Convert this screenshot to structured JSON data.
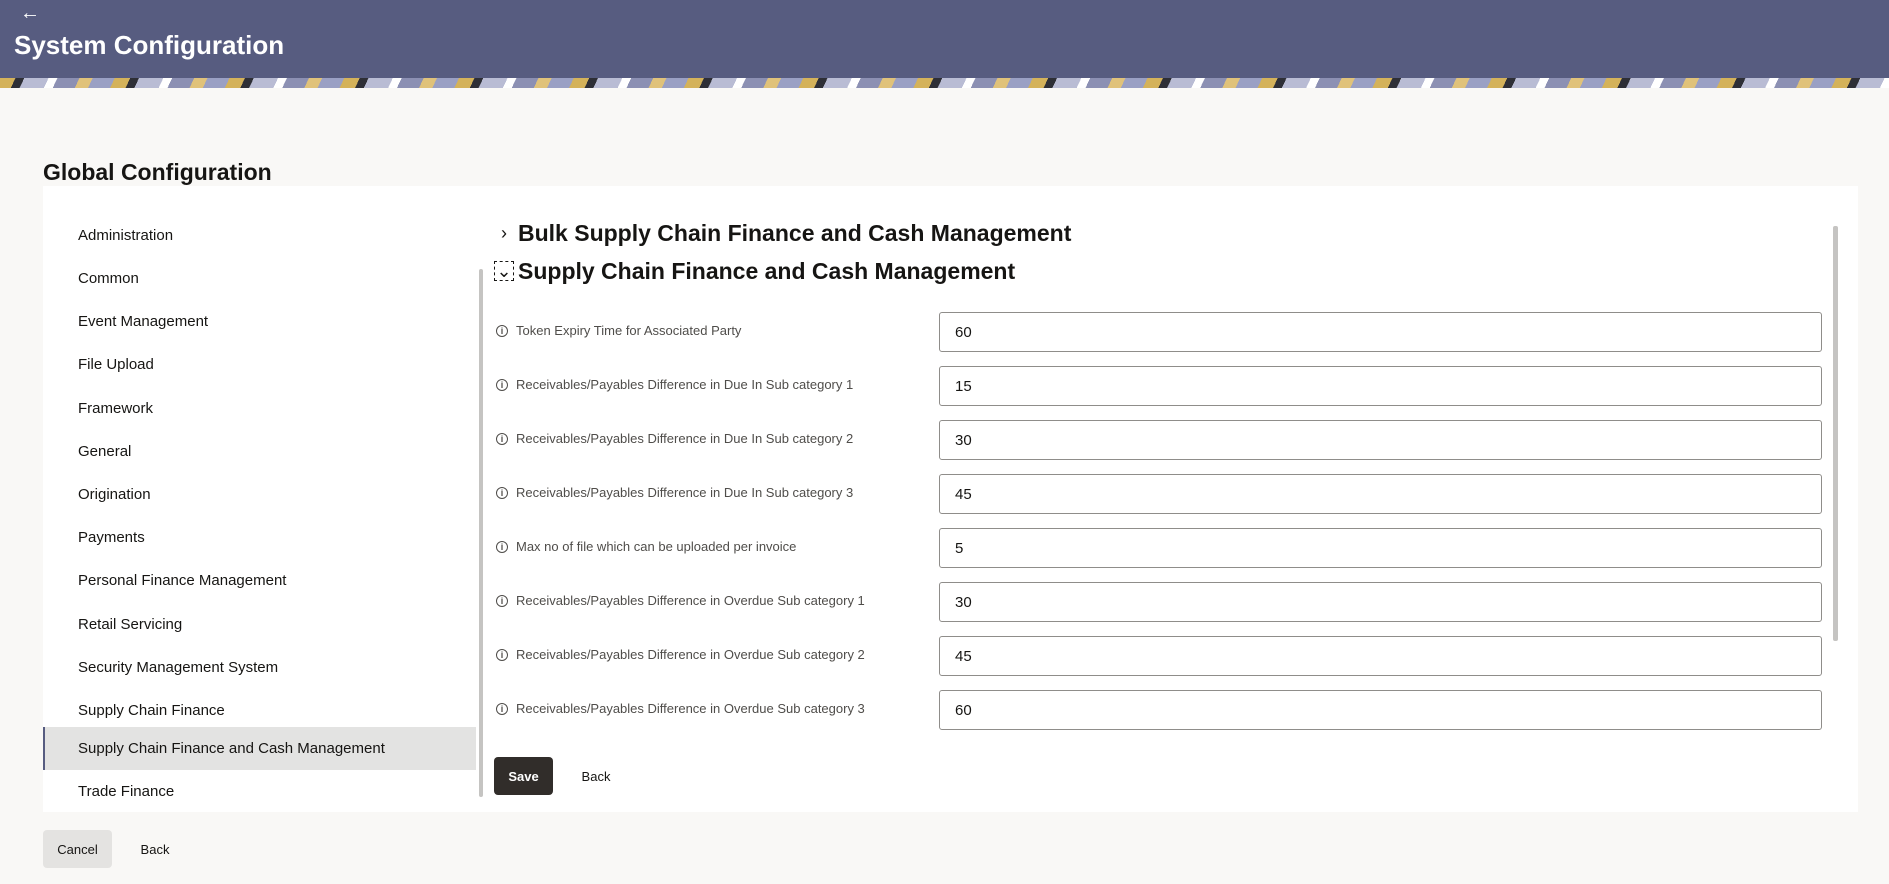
{
  "header": {
    "back_icon": "arrow-left-icon",
    "title": "System Configuration"
  },
  "section": {
    "title": "Global Configuration"
  },
  "nav": {
    "items": [
      {
        "label": "Administration"
      },
      {
        "label": "Common"
      },
      {
        "label": "Event Management"
      },
      {
        "label": "File Upload"
      },
      {
        "label": "Framework"
      },
      {
        "label": "General"
      },
      {
        "label": "Origination"
      },
      {
        "label": "Payments"
      },
      {
        "label": "Personal Finance Management"
      },
      {
        "label": "Retail Servicing"
      },
      {
        "label": "Security Management System"
      },
      {
        "label": "Supply Chain Finance"
      },
      {
        "label": "Supply Chain Finance and Cash Management"
      },
      {
        "label": "Trade Finance"
      }
    ],
    "active": "Supply Chain Finance and Cash Management"
  },
  "accordions": [
    {
      "label": "Bulk Supply Chain Finance and Cash Management",
      "expanded": false,
      "icon": "chevron-right-icon"
    },
    {
      "label": "Supply Chain Finance and Cash Management",
      "expanded": true,
      "icon": "chevron-down-icon"
    }
  ],
  "fields": [
    {
      "label": "Token Expiry Time for Associated Party",
      "value": "60"
    },
    {
      "label": "Receivables/Payables Difference in Due In Sub category 1",
      "value": "15"
    },
    {
      "label": "Receivables/Payables Difference in Due In Sub category 2",
      "value": "30"
    },
    {
      "label": "Receivables/Payables Difference in Due In Sub category 3",
      "value": "45"
    },
    {
      "label": "Max no of file which can be uploaded per invoice",
      "value": "5"
    },
    {
      "label": "Receivables/Payables Difference in Overdue Sub category 1",
      "value": "30"
    },
    {
      "label": "Receivables/Payables Difference in Overdue Sub category 2",
      "value": "45"
    },
    {
      "label": "Receivables/Payables Difference in Overdue Sub category 3",
      "value": "60"
    }
  ],
  "actions": {
    "save_label": "Save",
    "back_label": "Back",
    "cancel_label": "Cancel",
    "outer_back_label": "Back"
  },
  "colors": {
    "header_bg": "#575c80",
    "primary_button": "#312d2a",
    "active_nav_bg": "#e3e3e2"
  }
}
